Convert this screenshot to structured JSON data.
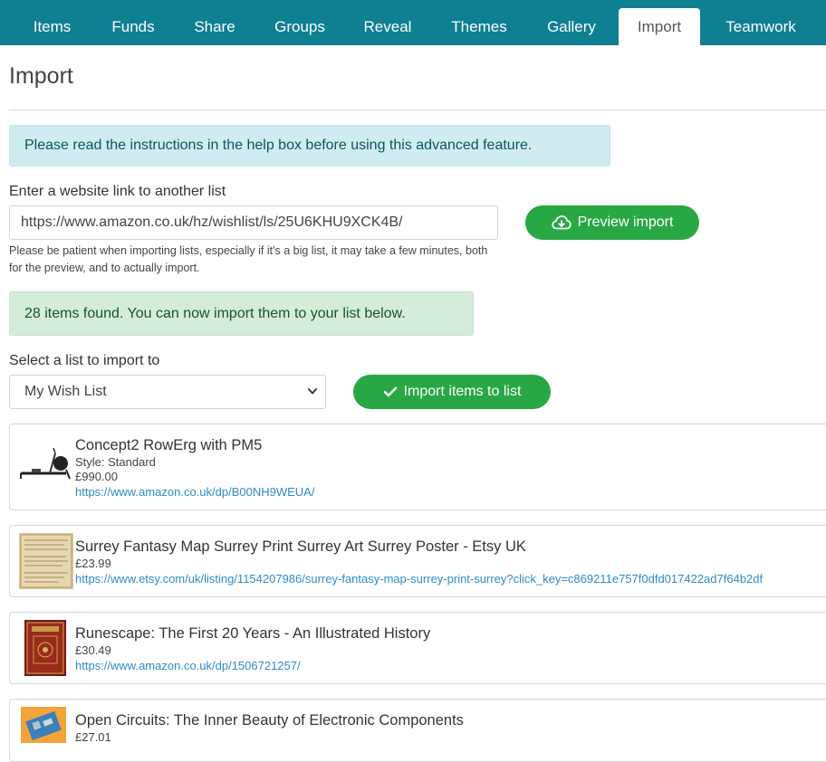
{
  "nav": {
    "tabs": [
      {
        "label": "Items"
      },
      {
        "label": "Funds"
      },
      {
        "label": "Share"
      },
      {
        "label": "Groups"
      },
      {
        "label": "Reveal"
      },
      {
        "label": "Themes"
      },
      {
        "label": "Gallery"
      },
      {
        "label": "Import",
        "active": true
      },
      {
        "label": "Teamwork"
      }
    ]
  },
  "page": {
    "title": "Import"
  },
  "info_alert": "Please read the instructions in the help box before using this advanced feature.",
  "url_field": {
    "label": "Enter a website link to another list",
    "value": "https://www.amazon.co.uk/hz/wishlist/ls/25U6KHU9XCK4B/"
  },
  "preview_button": {
    "label": "Preview import",
    "icon": "cloud-download-icon"
  },
  "help_text": "Please be patient when importing lists, especially if it's a big list, it may take a few minutes, both for the preview, and to actually import.",
  "success_alert": "28 items found. You can now import them to your list below.",
  "list_select": {
    "label": "Select a list to import to",
    "selected": "My Wish List"
  },
  "import_button": {
    "label": "Import items to list",
    "icon": "check-icon"
  },
  "items": [
    {
      "title": "Concept2 RowErg with PM5",
      "style": "Style: Standard",
      "price": "£990.00",
      "url": "https://www.amazon.co.uk/dp/B00NH9WEUA/",
      "thumb": "rowing-machine-image"
    },
    {
      "title": "Surrey Fantasy Map Surrey Print Surrey Art Surrey Poster - Etsy UK",
      "price": "£23.99",
      "url": "https://www.etsy.com/uk/listing/1154207986/surrey-fantasy-map-surrey-print-surrey?click_key=c869211e757f0dfd017422ad7f64b2df",
      "thumb": "map-poster-image"
    },
    {
      "title": "Runescape: The First 20 Years - An Illustrated History",
      "price": "£30.49",
      "url": "https://www.amazon.co.uk/dp/1506721257/",
      "thumb": "book-cover-image"
    },
    {
      "title": "Open Circuits: The Inner Beauty of Electronic Components",
      "price": "£27.01",
      "thumb": "circuit-book-image"
    }
  ],
  "colors": {
    "nav": "#0f7f92",
    "primary_button": "#28a745",
    "link": "#2f8ac9",
    "info_alert": "#d1ecf1",
    "success_alert": "#d4edda"
  }
}
